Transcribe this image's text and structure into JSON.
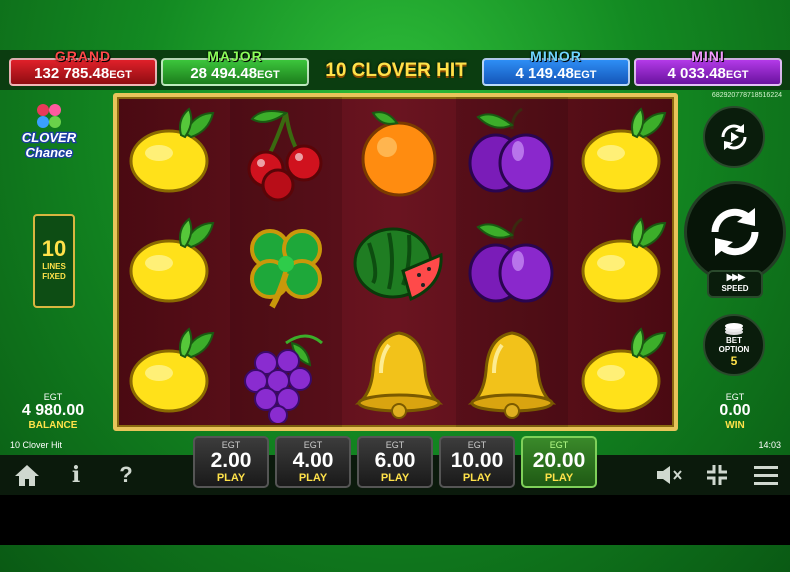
{
  "game_title": "10 CLOVER HIT",
  "game_id": "682920778718516224",
  "jackpots": {
    "grand": {
      "title": "GRAND",
      "value": "132 785.48",
      "currency": "EGT",
      "color": "#e0202a"
    },
    "major": {
      "title": "MAJOR",
      "value": "28 494.48",
      "currency": "EGT",
      "color": "#3cc53c"
    },
    "minor": {
      "title": "MINOR",
      "value": "4 149.48",
      "currency": "EGT",
      "color": "#2e8ef5"
    },
    "mini": {
      "title": "MINI",
      "value": "4 033.48",
      "currency": "EGT",
      "color": "#b33ae8"
    }
  },
  "logo": {
    "line1": "CLOVER",
    "line2": "Chance"
  },
  "lines": {
    "count": "10",
    "label1": "LINES",
    "label2": "FIXED"
  },
  "balance": {
    "currency": "EGT",
    "amount": "4 980.00",
    "label": "BALANCE"
  },
  "win": {
    "currency": "EGT",
    "amount": "0.00",
    "label": "WIN"
  },
  "speed": {
    "label": "SPEED",
    "icon": "fast-forward-icon"
  },
  "bet_option": {
    "label1": "BET",
    "label2": "OPTION",
    "value": "5"
  },
  "footer": {
    "game_name": "10 Clover Hit",
    "clock": "14:03"
  },
  "help_label": "?",
  "info_label": "i",
  "bets": [
    {
      "currency": "EGT",
      "amount": "2.00",
      "label": "PLAY",
      "active": false
    },
    {
      "currency": "EGT",
      "amount": "4.00",
      "label": "PLAY",
      "active": false
    },
    {
      "currency": "EGT",
      "amount": "6.00",
      "label": "PLAY",
      "active": false
    },
    {
      "currency": "EGT",
      "amount": "10.00",
      "label": "PLAY",
      "active": false
    },
    {
      "currency": "EGT",
      "amount": "20.00",
      "label": "PLAY",
      "active": true
    }
  ],
  "reels": [
    [
      "lemon",
      "lemon",
      "lemon"
    ],
    [
      "cherry",
      "clover",
      "grapes"
    ],
    [
      "orange",
      "watermelon",
      "bell"
    ],
    [
      "plum",
      "plum",
      "bell"
    ],
    [
      "lemon",
      "lemon",
      "lemon"
    ]
  ]
}
